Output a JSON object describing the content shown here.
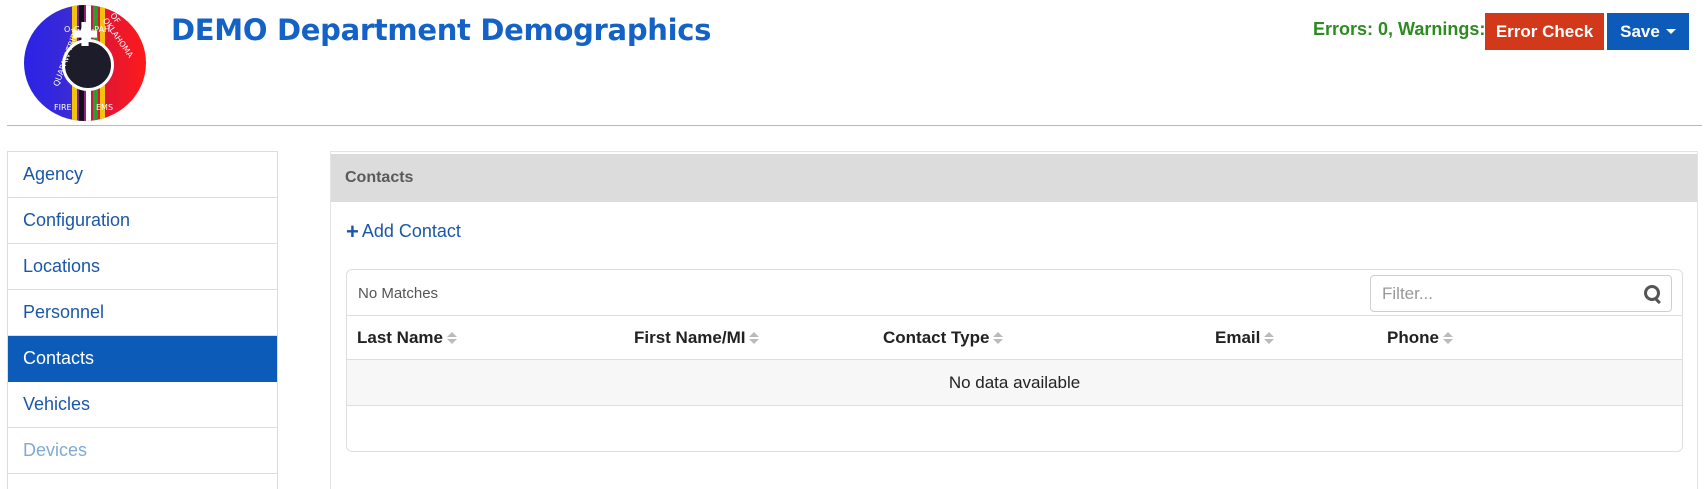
{
  "header": {
    "title": "DEMO Department Demographics",
    "status": "Errors: 0, Warnings: 0",
    "error_check_label": "Error Check",
    "save_label": "Save",
    "logo_text": {
      "top_left": "QUAPAW TRIBE",
      "top_right": "OF OKLAHOMA",
      "middle": "O-GAH-PAH",
      "bottom_left": "FIRE",
      "bottom_right": "EMS"
    }
  },
  "sidebar": {
    "items": [
      {
        "label": "Agency"
      },
      {
        "label": "Configuration"
      },
      {
        "label": "Locations"
      },
      {
        "label": "Personnel"
      },
      {
        "label": "Contacts"
      },
      {
        "label": "Vehicles"
      },
      {
        "label": "Devices"
      }
    ],
    "active_index": 4
  },
  "panel": {
    "heading": "Contacts",
    "add_label": "Add Contact",
    "table": {
      "info": "No Matches",
      "filter_placeholder": "Filter...",
      "columns": [
        "Last Name",
        "First Name/MI",
        "Contact Type",
        "Email",
        "Phone"
      ],
      "empty_text": "No data available"
    }
  },
  "colors": {
    "brand_blue": "#0d5bb8",
    "error_red": "#d2381a",
    "status_green": "#2e8b22"
  },
  "icons": {
    "add": "plus-icon",
    "filter": "search-icon",
    "sort": "sort-icon",
    "save_menu": "caret-down-icon"
  }
}
